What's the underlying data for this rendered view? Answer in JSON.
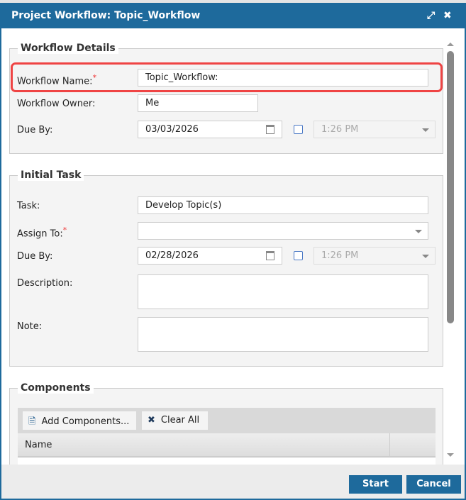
{
  "dialog": {
    "title": "Project Workflow: Topic_Workflow"
  },
  "workflow_details": {
    "legend": "Workflow Details",
    "name_label": "Workflow Name:",
    "name_value": "Topic_Workflow:",
    "owner_label": "Workflow Owner:",
    "owner_value": "Me",
    "due_label": "Due By:",
    "due_date": "03/03/2026",
    "due_time": "1:26 PM"
  },
  "initial_task": {
    "legend": "Initial Task",
    "task_label": "Task:",
    "task_value": "Develop Topic(s)",
    "assign_label": "Assign To:",
    "assign_value": "",
    "due_label": "Due By:",
    "due_date": "02/28/2026",
    "due_time": "1:26 PM",
    "description_label": "Description:",
    "note_label": "Note:"
  },
  "components": {
    "legend": "Components",
    "add_label": "Add Components...",
    "clear_label": "Clear All",
    "col_name": "Name"
  },
  "required_mark": "*",
  "footer": {
    "start": "Start",
    "cancel": "Cancel"
  }
}
